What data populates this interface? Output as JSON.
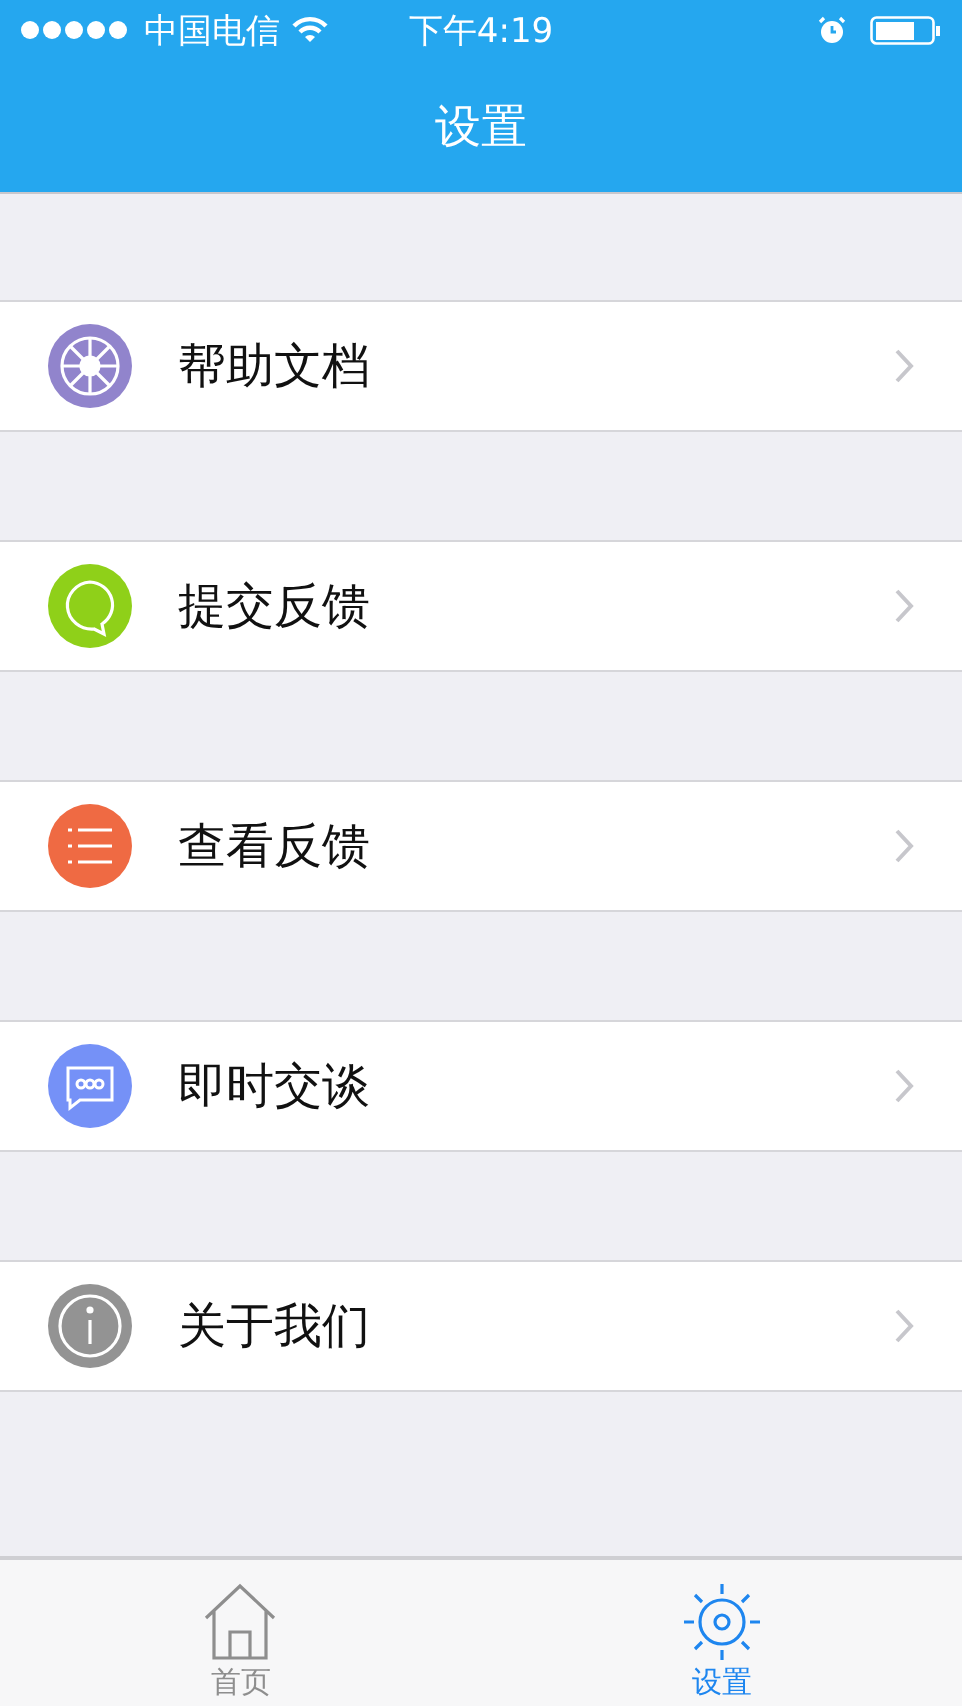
{
  "status_bar": {
    "carrier": "中国电信",
    "time": "下午4:19"
  },
  "nav_bar": {
    "title": "设置"
  },
  "menu": [
    {
      "label": "帮助文档",
      "kind": "lifebuoy",
      "color": "#9184cc"
    },
    {
      "label": "提交反馈",
      "kind": "bubble",
      "color": "#8fd019"
    },
    {
      "label": "查看反馈",
      "kind": "list",
      "color": "#ef6a43"
    },
    {
      "label": "即时交谈",
      "kind": "chat",
      "color": "#7591f7"
    },
    {
      "label": "关于我们",
      "kind": "info",
      "color": "#939393"
    }
  ],
  "tab_bar": [
    {
      "label": "首页",
      "kind": "home",
      "selected": false
    },
    {
      "label": "设置",
      "kind": "gear",
      "selected": true
    }
  ]
}
